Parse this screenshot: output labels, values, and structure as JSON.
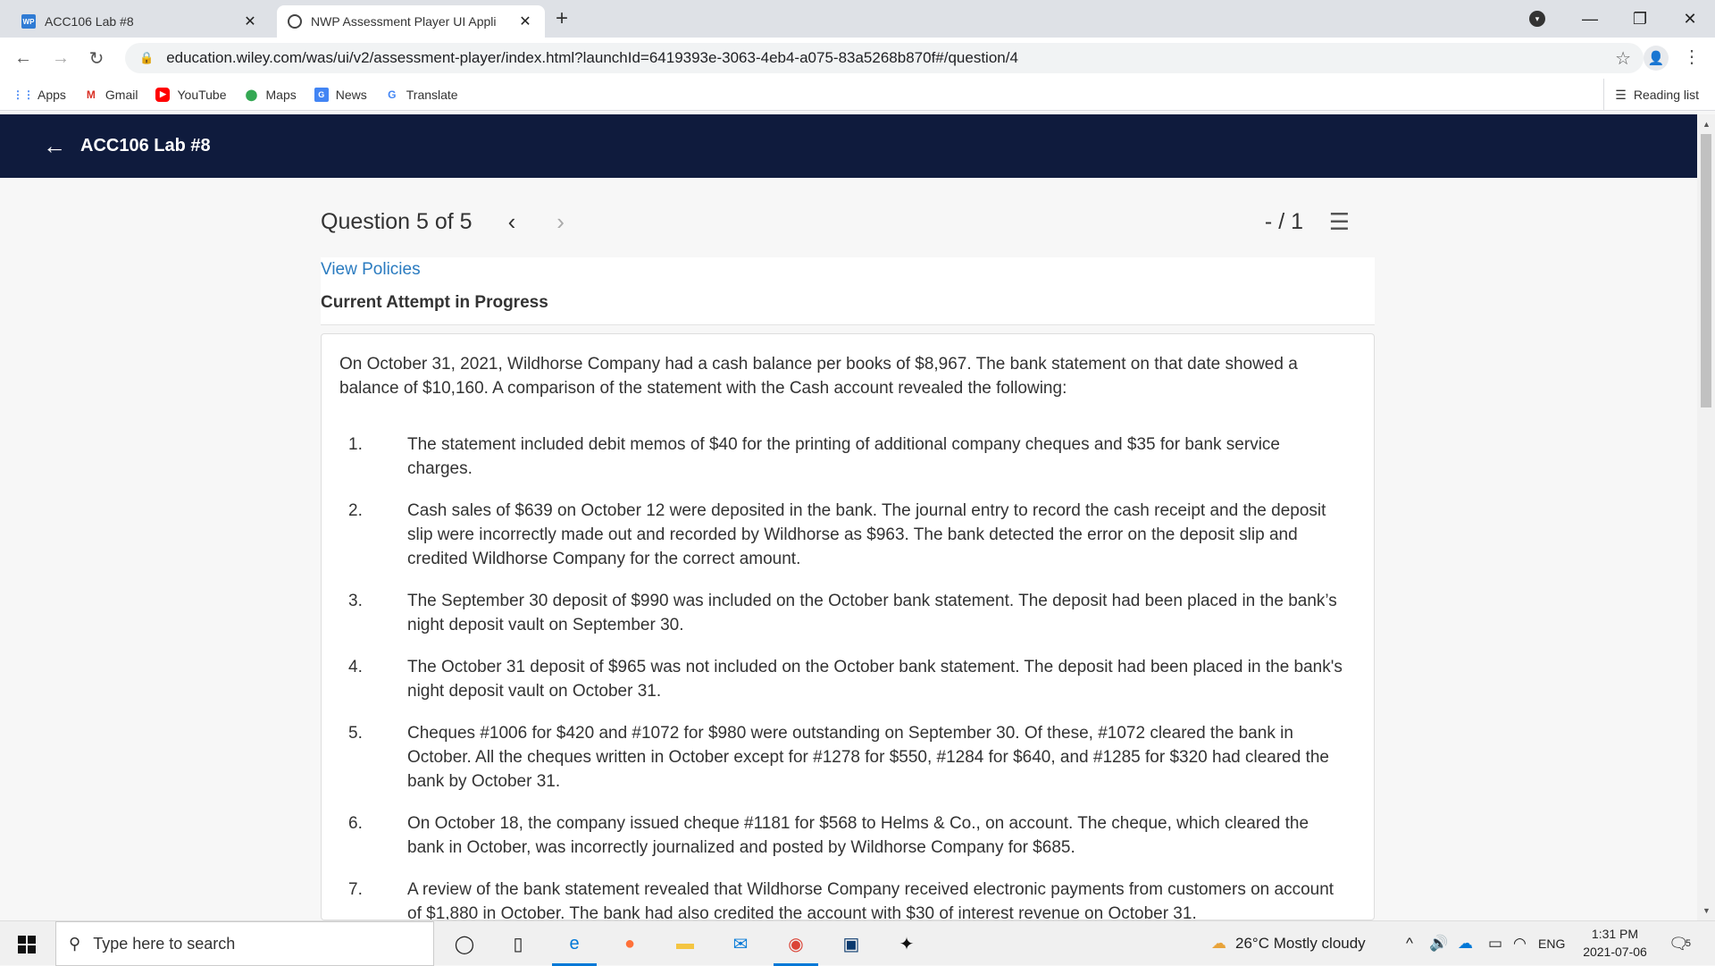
{
  "browser": {
    "tabs": [
      {
        "label": "ACC106 Lab #8",
        "favicon": "WP"
      },
      {
        "label": "NWP Assessment Player UI Appli",
        "favicon": "globe"
      }
    ],
    "url": "education.wiley.com/was/ui/v2/assessment-player/index.html?launchId=6419393e-3063-4eb4-a075-83a5268b870f#/question/4",
    "bookmarks": [
      "Apps",
      "Gmail",
      "YouTube",
      "Maps",
      "News",
      "Translate"
    ],
    "reading_list": "Reading list"
  },
  "app": {
    "title": "ACC106 Lab #8",
    "header_color": "#0f1b3d"
  },
  "question": {
    "position": "Question 5 of 5",
    "score": "- / 1",
    "view_policies": "View Policies",
    "attempt_status": "Current Attempt in Progress",
    "intro": "On October 31, 2021, Wildhorse Company had a cash balance per books of $8,967. The bank statement on that date showed a balance of $10,160. A comparison of the statement with the Cash account revealed the following:",
    "items": [
      {
        "num": "1.",
        "text": "The statement included debit memos of $40 for the printing of additional company cheques and $35 for bank service charges."
      },
      {
        "num": "2.",
        "text": "Cash sales of $639 on October 12 were deposited in the bank. The journal entry to record the cash receipt and the deposit slip were incorrectly made out and recorded by Wildhorse as $963. The bank detected the error on the deposit slip and credited Wildhorse Company for the correct amount."
      },
      {
        "num": "3.",
        "text": "The September 30 deposit of $990 was included on the October bank statement. The deposit had been placed in the bank’s night deposit vault on September 30."
      },
      {
        "num": "4.",
        "text": "The October 31 deposit of $965 was not included on the October bank statement. The deposit had been placed in the bank's night deposit vault on October 31."
      },
      {
        "num": "5.",
        "text": "Cheques #1006 for $420 and #1072 for $980 were outstanding on September 30. Of these, #1072 cleared the bank in October. All the cheques written in October except for #1278 for $550, #1284 for $640, and #1285 for $320 had cleared the bank by October 31."
      },
      {
        "num": "6.",
        "text": "On October 18, the company issued cheque #1181 for $568 to Helms & Co., on account. The cheque, which cleared the bank in October, was incorrectly journalized and posted by Wildhorse Company for $685."
      },
      {
        "num": "7.",
        "text": "A review of the bank statement revealed that Wildhorse Company received electronic payments from customers on account of $1,880 in October. The bank had also credited the account with $30 of interest revenue on October 31."
      }
    ]
  },
  "taskbar": {
    "search_placeholder": "Type here to search",
    "weather": "26°C  Mostly cloudy",
    "language": "ENG",
    "time": "1:31 PM",
    "date": "2021-07-06",
    "notification_count": "5"
  }
}
